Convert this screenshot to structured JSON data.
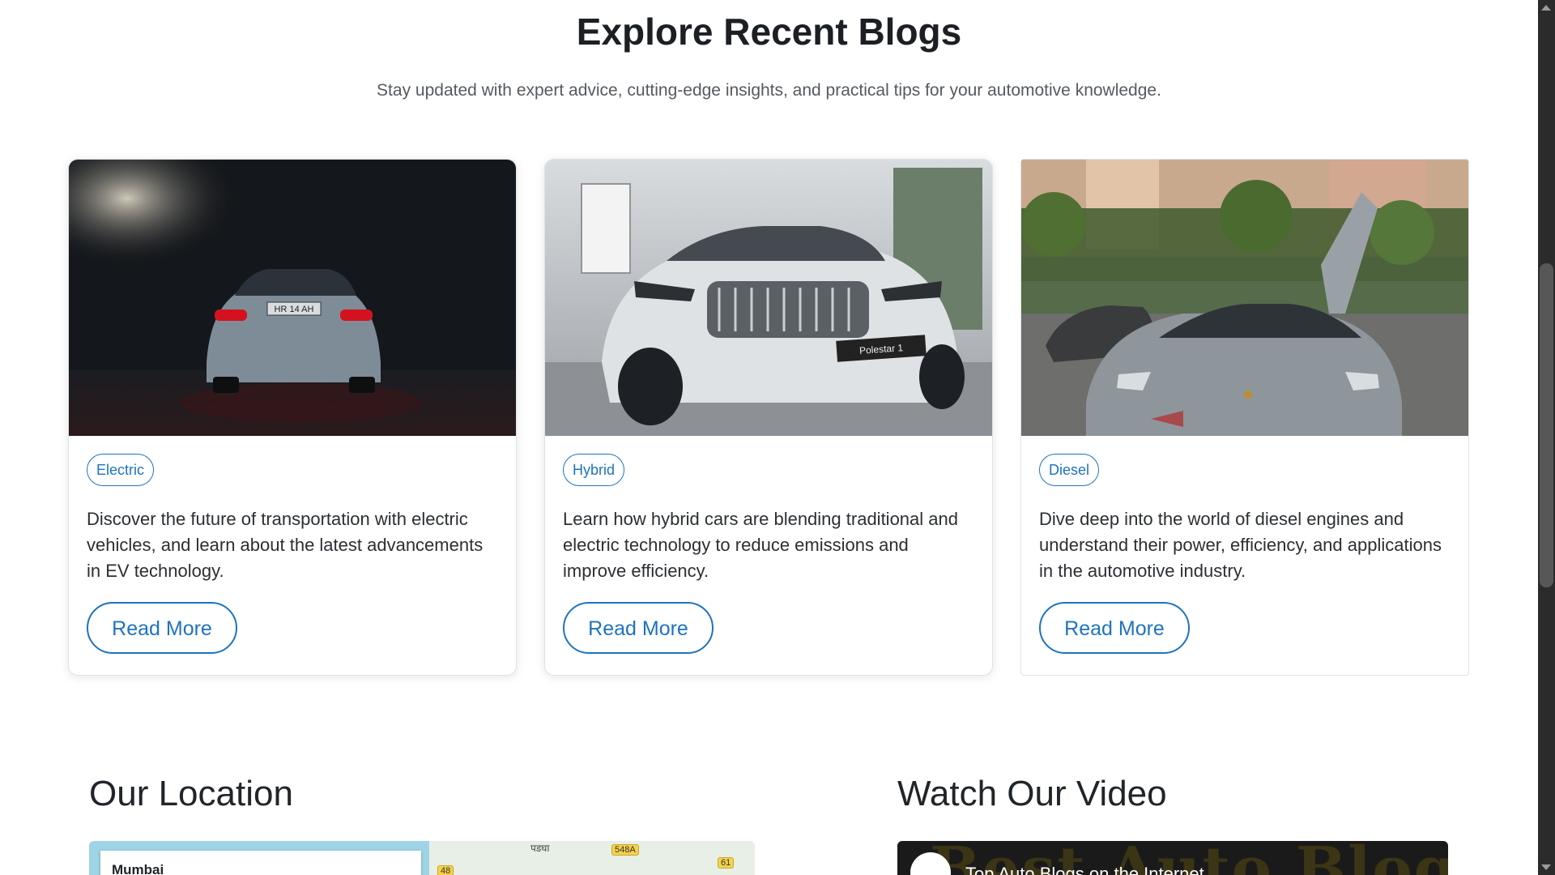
{
  "blogs": {
    "title": "Explore Recent Blogs",
    "subtitle": "Stay updated with expert advice, cutting-edge insights, and practical tips for your automotive knowledge.",
    "cards": [
      {
        "tag": "Electric",
        "text": "Discover the future of transportation with electric vehicles, and learn about the latest advancements in EV technology.",
        "button": "Read More",
        "plate": "HR 14 AH"
      },
      {
        "tag": "Hybrid",
        "text": "Learn how hybrid cars are blending traditional and electric technology to reduce emissions and improve efficiency.",
        "button": "Read More",
        "plate": "Polestar 1"
      },
      {
        "tag": "Diesel",
        "text": "Dive deep into the world of diesel engines and understand their power, efficiency, and applications in the automotive industry.",
        "button": "Read More"
      }
    ]
  },
  "location": {
    "title": "Our Location",
    "map_search": "Mumbai",
    "map_labels": [
      "पडघा",
      "548A",
      "61",
      "48"
    ]
  },
  "video": {
    "title": "Watch Our Video",
    "thumbnail_text": "Best Auto Blogs",
    "video_title": "Top Auto Blogs on the Internet"
  },
  "colors": {
    "accent": "#1e73be",
    "scrollbar": "#2b2b2b"
  }
}
